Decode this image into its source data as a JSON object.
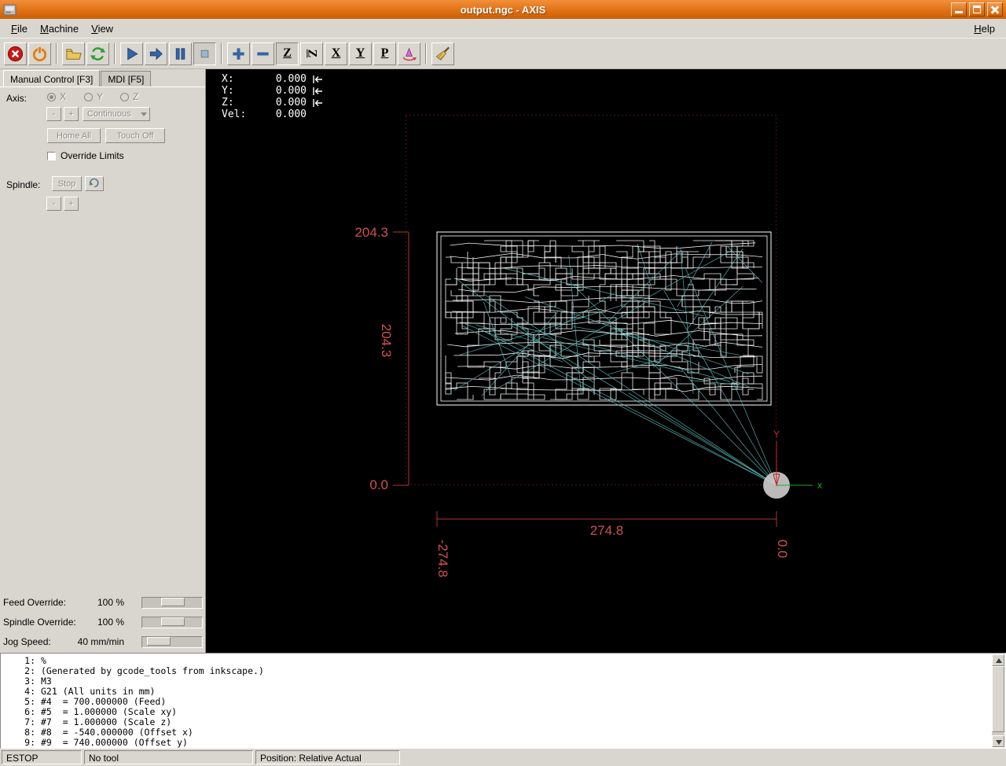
{
  "window": {
    "title": "output.ngc - AXIS",
    "control_icons": [
      "minimize-icon",
      "maximize-icon",
      "close-icon"
    ]
  },
  "menubar": {
    "items": [
      "File",
      "Machine",
      "View"
    ],
    "help": "Help"
  },
  "toolbar": {
    "icons": [
      "estop-icon",
      "machine-power-icon",
      "open-file-icon",
      "reload-icon",
      "run-icon",
      "step-icon",
      "pause-icon",
      "stop-icon",
      "zoom-in-icon",
      "zoom-out-icon",
      "view-top-icon",
      "view-rotated-top-icon",
      "view-side-icon",
      "view-front-icon",
      "view-perspective-icon",
      "rotate-view-icon",
      "clear-plot-icon"
    ],
    "view_letters": {
      "top": "Z",
      "rotated": "Z",
      "side": "X",
      "front": "Y",
      "perspective": "P"
    }
  },
  "manual": {
    "tab_manual": "Manual Control [F3]",
    "tab_mdi": "MDI [F5]",
    "axis_label": "Axis:",
    "axis_options": [
      "X",
      "Y",
      "Z"
    ],
    "jog_minus": "-",
    "jog_plus": "+",
    "jog_mode": "Continuous",
    "home_all": "Home All",
    "touch_off": "Touch Off",
    "override_limits": "Override Limits",
    "spindle_label": "Spindle:",
    "spindle_stop": "Stop",
    "spindle_minus": "-",
    "spindle_plus": "+"
  },
  "overrides": {
    "feed": {
      "label": "Feed Override:",
      "value": "100 %"
    },
    "spindle": {
      "label": "Spindle Override:",
      "value": "100 %"
    },
    "jog": {
      "label": "Jog Speed:",
      "value": "40 mm/min"
    }
  },
  "dro": {
    "rows": [
      {
        "label": "X:",
        "value": "0.000",
        "homed": true
      },
      {
        "label": "Y:",
        "value": "0.000",
        "homed": true
      },
      {
        "label": "Z:",
        "value": "0.000",
        "homed": true
      },
      {
        "label": "Vel:",
        "value": "0.000",
        "homed": false
      }
    ],
    "homed_icon": "homed-arrow-icon"
  },
  "preview": {
    "labels": {
      "y_max": "204.3",
      "y_extent": "204.3",
      "y_min": "0.0",
      "x_extent": "274.8",
      "x_min": "-274.8",
      "x_max": "0.0",
      "axis_x": "x",
      "axis_y": "Y"
    },
    "colors": {
      "dimension": "#d05050",
      "limits_boundary": "#9b2a2a",
      "toolpath": "#ffffff",
      "rapid": "#63c9c9",
      "axis_x": "#22aa22",
      "axis_y": "#cc2222",
      "background": "#000000"
    }
  },
  "gcode": {
    "lines": [
      {
        "num": "1:",
        "text": "%"
      },
      {
        "num": "2:",
        "text": "(Generated by gcode_tools from inkscape.)"
      },
      {
        "num": "3:",
        "text": "M3"
      },
      {
        "num": "4:",
        "text": "G21 (All units in mm)"
      },
      {
        "num": "5:",
        "text": "#4  = 700.000000 (Feed)"
      },
      {
        "num": "6:",
        "text": "#5  = 1.000000 (Scale xy)"
      },
      {
        "num": "7:",
        "text": "#7  = 1.000000 (Scale z)"
      },
      {
        "num": "8:",
        "text": "#8  = -540.000000 (Offset x)"
      },
      {
        "num": "9:",
        "text": "#9  = 740.000000 (Offset y)"
      }
    ]
  },
  "statusbar": {
    "cells": [
      "ESTOP",
      "No tool",
      "Position: Relative Actual"
    ]
  }
}
